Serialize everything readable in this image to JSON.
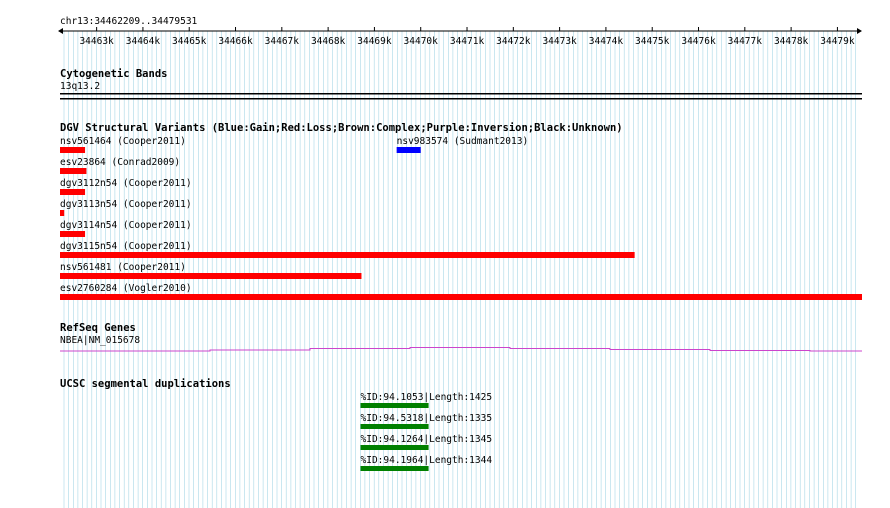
{
  "region": {
    "label": "chr13:34462209..34479531",
    "start": 34462209,
    "end": 34479531,
    "ticks": [
      "34463k",
      "34464k",
      "34465k",
      "34466k",
      "34467k",
      "34468k",
      "34469k",
      "34470k",
      "34471k",
      "34472k",
      "34473k",
      "34474k",
      "34475k",
      "34476k",
      "34477k",
      "34478k",
      "34479k"
    ]
  },
  "colors": {
    "grid": "#a8d7e6",
    "loss": "#ff0000",
    "gain": "#0000ff",
    "refseq": "#cc44cc",
    "segdup": "#008000",
    "text": "#000000"
  },
  "tracks": {
    "cytoband": {
      "title": "Cytogenetic Bands",
      "band_label": "13q13.2"
    },
    "dgv": {
      "title": "DGV Structural Variants (Blue:Gain;Red:Loss;Brown:Complex;Purple:Inversion;Black:Unknown)",
      "features": [
        {
          "label": "nsv561464 (Cooper2011)",
          "type": "loss",
          "start": 34462209,
          "end": 34462750
        },
        {
          "label": "nsv983574 (Sudmant2013)",
          "type": "gain",
          "start": 34469480,
          "end": 34470000
        },
        {
          "label": "esv23864 (Conrad2009)",
          "type": "loss",
          "start": 34462209,
          "end": 34462780
        },
        {
          "label": "dgv3112n54 (Cooper2011)",
          "type": "loss",
          "start": 34462209,
          "end": 34462750
        },
        {
          "label": "dgv3113n54 (Cooper2011)",
          "type": "loss",
          "start": 34462209,
          "end": 34462300
        },
        {
          "label": "dgv3114n54 (Cooper2011)",
          "type": "loss",
          "start": 34462209,
          "end": 34462750
        },
        {
          "label": "dgv3115n54 (Cooper2011)",
          "type": "loss",
          "start": 34462209,
          "end": 34474620
        },
        {
          "label": "nsv561481 (Cooper2011)",
          "type": "loss",
          "start": 34462209,
          "end": 34468720
        },
        {
          "label": "esv2760284 (Vogler2010)",
          "type": "loss",
          "start": 34462209,
          "end": 34479531
        }
      ]
    },
    "refseq": {
      "title": "RefSeq Genes",
      "gene_label": "NBEA|NM_015678"
    },
    "segdup": {
      "title": "UCSC segmental duplications",
      "features": [
        {
          "label": "%ID:94.1053|Length:1425",
          "start": 34468700,
          "end": 34470170
        },
        {
          "label": "%ID:94.5318|Length:1335",
          "start": 34468700,
          "end": 34470170
        },
        {
          "label": "%ID:94.1264|Length:1345",
          "start": 34468700,
          "end": 34470170
        },
        {
          "label": "%ID:94.1964|Length:1344",
          "start": 34468700,
          "end": 34470170
        }
      ]
    }
  }
}
